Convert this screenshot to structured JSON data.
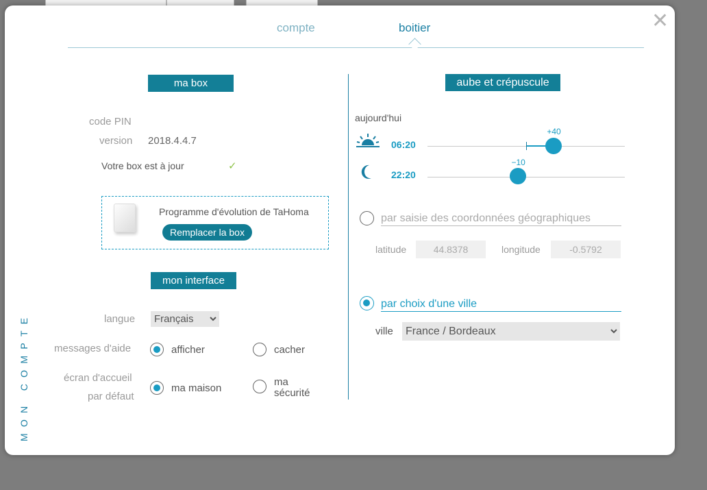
{
  "tabs": [
    {
      "label": "compte",
      "active": false
    },
    {
      "label": "boitier",
      "active": true
    }
  ],
  "close_icon": "close-x",
  "vertical_label": "MON COMPTE",
  "box": {
    "title": "ma box",
    "pin_label": "code PIN",
    "pin_value": "",
    "version_label": "version",
    "version_value": "2018.4.4.7",
    "status": "Votre box est à jour",
    "status_icon": "checkmark",
    "promo_text": "Programme d'évolution de TaHoma",
    "promo_button": "Remplacer la box"
  },
  "interface": {
    "title": "mon interface",
    "language_label": "langue",
    "language_value": "Français",
    "help_label": "messages d'aide",
    "help_options": [
      {
        "label": "afficher",
        "selected": true
      },
      {
        "label": "cacher",
        "selected": false
      }
    ],
    "home_label_line1": "écran d'accueil",
    "home_label_line2": "par défaut",
    "home_options": [
      {
        "label": "ma maison",
        "selected": true
      },
      {
        "label_line1": "ma",
        "label_line2": "sécurité",
        "selected": false
      }
    ]
  },
  "dawn_dusk": {
    "title": "aube et crépuscule",
    "today_label": "aujourd'hui",
    "sunrise": {
      "icon": "sunrise-icon",
      "time": "06:20",
      "offset": "+40",
      "level": 0.64
    },
    "sunset": {
      "icon": "moon-icon",
      "time": "22:20",
      "offset": "−10",
      "level": 0.46
    },
    "geo_option": "par saisie des coordonnées géographiques",
    "geo_selected": false,
    "latitude_label": "latitude",
    "latitude_value": "44.8378",
    "longitude_label": "longitude",
    "longitude_value": "-0.5792",
    "city_option": "par choix d'une ville",
    "city_selected": true,
    "city_label": "ville",
    "city_value": "France / Bordeaux"
  },
  "colors": {
    "accent": "#1a9cc3",
    "header_bg": "#137f97",
    "check": "#8fc34a"
  }
}
